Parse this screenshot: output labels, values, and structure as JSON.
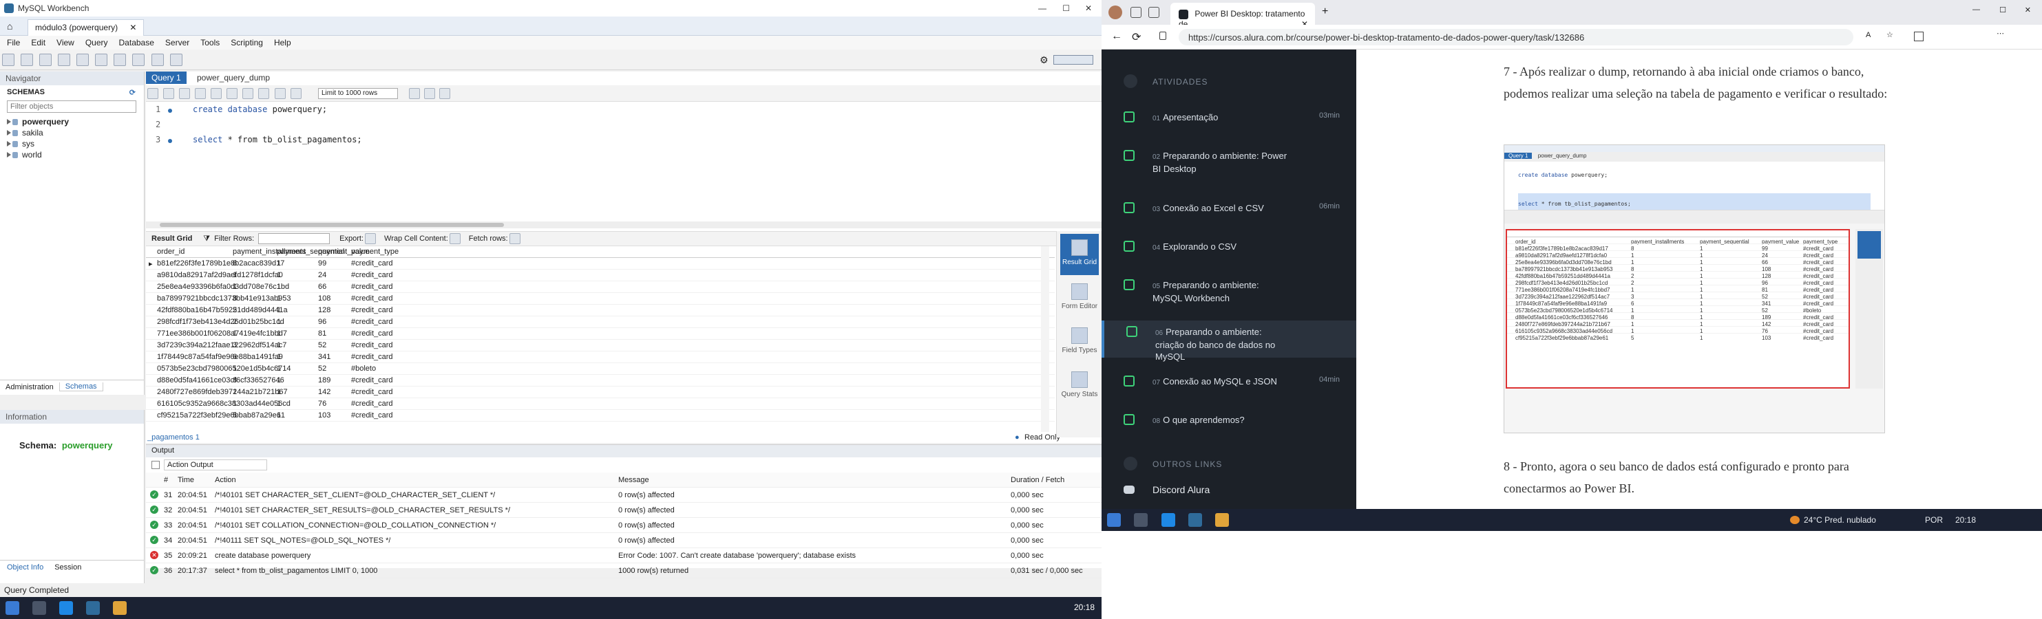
{
  "workbench": {
    "window_title": "MySQL Workbench",
    "tabs": [
      "módulo3 (powerquery)"
    ],
    "menu": [
      "File",
      "Edit",
      "View",
      "Query",
      "Database",
      "Server",
      "Tools",
      "Scripting",
      "Help"
    ],
    "navigator": {
      "title": "Navigator",
      "schemas_label": "SCHEMAS",
      "filter_placeholder": "Filter objects",
      "schemas": [
        "powerquery",
        "sakila",
        "sys",
        "world"
      ],
      "bottom_tabs": [
        "Administration",
        "Schemas"
      ]
    },
    "information": {
      "title": "Information",
      "schema_label": "Schema:",
      "schema_value": "powerquery",
      "bottom_tabs": [
        "Object Info",
        "Session"
      ]
    },
    "editor": {
      "tabs": [
        "Query 1",
        "power_query_dump"
      ],
      "limit_label": "Limit to 1000 rows",
      "lines": [
        {
          "n": "1",
          "kw": "create database",
          "rest": " powerquery;"
        },
        {
          "n": "2",
          "kw": "",
          "rest": ""
        },
        {
          "n": "3",
          "kw": "select",
          "rest": " * from tb_olist_pagamentos;"
        }
      ]
    },
    "result": {
      "toolbar": {
        "result_grid": "Result Grid",
        "filter_rows": "Filter Rows:",
        "export": "Export:",
        "wrap": "Wrap Cell Content:",
        "fetch": "Fetch rows:"
      },
      "columns": [
        "order_id",
        "payment_installments",
        "payment_sequential",
        "payment_value",
        "payment_type"
      ],
      "rows": [
        [
          "b81ef226f3fe1789b1e8b2acac839d17",
          "8",
          "1",
          "99",
          "#credit_card"
        ],
        [
          "a9810da82917af2d9aefd1278f1dcfa0",
          "1",
          "1",
          "24",
          "#credit_card"
        ],
        [
          "25e8ea4e93396b6fa0d3dd708e76c1bd",
          "1",
          "1",
          "66",
          "#credit_card"
        ],
        [
          "ba78997921bbcdc1373bb41e913ab953",
          "8",
          "1",
          "108",
          "#credit_card"
        ],
        [
          "42fdf880ba16b47b59251dd489d4441a",
          "2",
          "1",
          "128",
          "#credit_card"
        ],
        [
          "298fcdf1f73eb413e4d26d01b25bc1cd",
          "2",
          "1",
          "96",
          "#credit_card"
        ],
        [
          "771ee386b001f06208a7419e4fc1bbd7",
          "1",
          "1",
          "81",
          "#credit_card"
        ],
        [
          "3d7239c394a212faae122962df514ac7",
          "3",
          "1",
          "52",
          "#credit_card"
        ],
        [
          "1f78449c87a54faf9e96e88ba1491fa9",
          "6",
          "1",
          "341",
          "#credit_card"
        ],
        [
          "0573b5e23cbd798006520e1d5b4c6714",
          "1",
          "1",
          "52",
          "#boleto"
        ],
        [
          "d88e0d5fa41661ce03cf6cf336527646",
          "8",
          "1",
          "189",
          "#credit_card"
        ],
        [
          "2480f727e869fdeb397244a21b721b67",
          "1",
          "1",
          "142",
          "#credit_card"
        ],
        [
          "616105c9352a9668c38303ad44e056cd",
          "1",
          "1",
          "76",
          "#credit_card"
        ],
        [
          "cf95215a722f3ebf29e6bbab87a29e61",
          "5",
          "1",
          "103",
          "#credit_card"
        ]
      ],
      "tab_label": "_pagamentos 1",
      "read_only": "Read Only",
      "side_buttons": [
        "Result Grid",
        "Form Editor",
        "Field Types",
        "Query Stats"
      ]
    },
    "output": {
      "title": "Output",
      "mode": "Action Output",
      "columns": [
        "#",
        "Time",
        "Action",
        "Message",
        "Duration / Fetch"
      ],
      "rows": [
        {
          "status": "ok",
          "n": "31",
          "time": "20:04:51",
          "action": "/*!40101 SET CHARACTER_SET_CLIENT=@OLD_CHARACTER_SET_CLIENT */",
          "message": "0 row(s) affected",
          "duration": "0,000 sec"
        },
        {
          "status": "ok",
          "n": "32",
          "time": "20:04:51",
          "action": "/*!40101 SET CHARACTER_SET_RESULTS=@OLD_CHARACTER_SET_RESULTS */",
          "message": "0 row(s) affected",
          "duration": "0,000 sec"
        },
        {
          "status": "ok",
          "n": "33",
          "time": "20:04:51",
          "action": "/*!40101 SET COLLATION_CONNECTION=@OLD_COLLATION_CONNECTION */",
          "message": "0 row(s) affected",
          "duration": "0,000 sec"
        },
        {
          "status": "ok",
          "n": "34",
          "time": "20:04:51",
          "action": "/*!40111 SET SQL_NOTES=@OLD_SQL_NOTES */",
          "message": "0 row(s) affected",
          "duration": "0,000 sec"
        },
        {
          "status": "err",
          "n": "35",
          "time": "20:09:21",
          "action": "create database powerquery",
          "message": "Error Code: 1007. Can't create database 'powerquery'; database exists",
          "duration": "0,000 sec"
        },
        {
          "status": "ok",
          "n": "36",
          "time": "20:17:37",
          "action": "select * from tb_olist_pagamentos LIMIT 0, 1000",
          "message": "1000 row(s) returned",
          "duration": "0,031 sec / 0,000 sec"
        }
      ]
    },
    "status": "Query Completed",
    "clock": "20:18"
  },
  "browser": {
    "tab_title": "Power BI Desktop: tratamento de",
    "url": "https://cursos.alura.com.br/course/power-bi-desktop-tratamento-de-dados-power-query/task/132686",
    "sidebar": {
      "section": "ATIVIDADES",
      "lessons": [
        {
          "num": "01",
          "title": "Apresentação",
          "dur": "03min",
          "active": false
        },
        {
          "num": "02",
          "title": "Preparando o ambiente: Power BI Desktop",
          "dur": "",
          "active": false
        },
        {
          "num": "03",
          "title": "Conexão ao Excel e CSV",
          "dur": "06min",
          "active": false
        },
        {
          "num": "04",
          "title": "Explorando o CSV",
          "dur": "",
          "active": false
        },
        {
          "num": "05",
          "title": "Preparando o ambiente: MySQL Workbench",
          "dur": "",
          "active": false
        },
        {
          "num": "06",
          "title": "Preparando o ambiente: criação do banco de dados no MySQL",
          "dur": "",
          "active": true
        },
        {
          "num": "07",
          "title": "Conexão ao MySQL e JSON",
          "dur": "04min",
          "active": false
        },
        {
          "num": "08",
          "title": "O que aprendemos?",
          "dur": "",
          "active": false
        }
      ],
      "other_section": "OUTROS LINKS",
      "discord": "Discord Alura"
    },
    "content": {
      "para7": "7 - Após realizar o dump, retornando à aba inicial onde criamos o banco, podemos realizar uma seleção na tabela de pagamento e verificar o resultado:",
      "para8": "8 - Pronto, agora o seu banco de dados está configurado e pronto para conectarmos ao Power BI."
    },
    "taskbar": {
      "weather": "24°C  Pred. nublado",
      "lang": "POR",
      "time": "20:18"
    }
  }
}
